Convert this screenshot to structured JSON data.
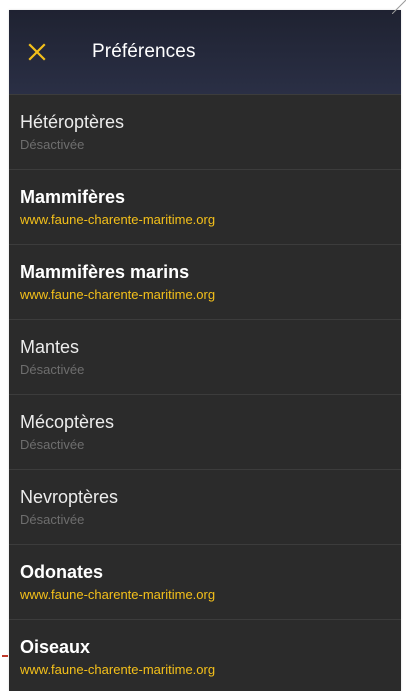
{
  "header": {
    "title": "Préférences",
    "close_icon": "close-icon",
    "accent": "#f4c01a"
  },
  "items": [
    {
      "title": "Hétéroptères",
      "subtitle": "Désactivée",
      "enabled": false
    },
    {
      "title": "Mammifères",
      "subtitle": "www.faune-charente-maritime.org",
      "enabled": true
    },
    {
      "title": "Mammifères marins",
      "subtitle": "www.faune-charente-maritime.org",
      "enabled": true
    },
    {
      "title": "Mantes",
      "subtitle": "Désactivée",
      "enabled": false
    },
    {
      "title": "Mécoptères",
      "subtitle": "Désactivée",
      "enabled": false
    },
    {
      "title": "Nevroptères",
      "subtitle": "Désactivée",
      "enabled": false
    },
    {
      "title": "Odonates",
      "subtitle": "www.faune-charente-maritime.org",
      "enabled": true
    },
    {
      "title": "Oiseaux",
      "subtitle": "www.faune-charente-maritime.org",
      "enabled": true
    }
  ],
  "colors": {
    "background": "#2b2b2b",
    "header": "#232739",
    "enabled_subtitle": "#f4c01a",
    "disabled_subtitle": "#6e6e6e"
  }
}
